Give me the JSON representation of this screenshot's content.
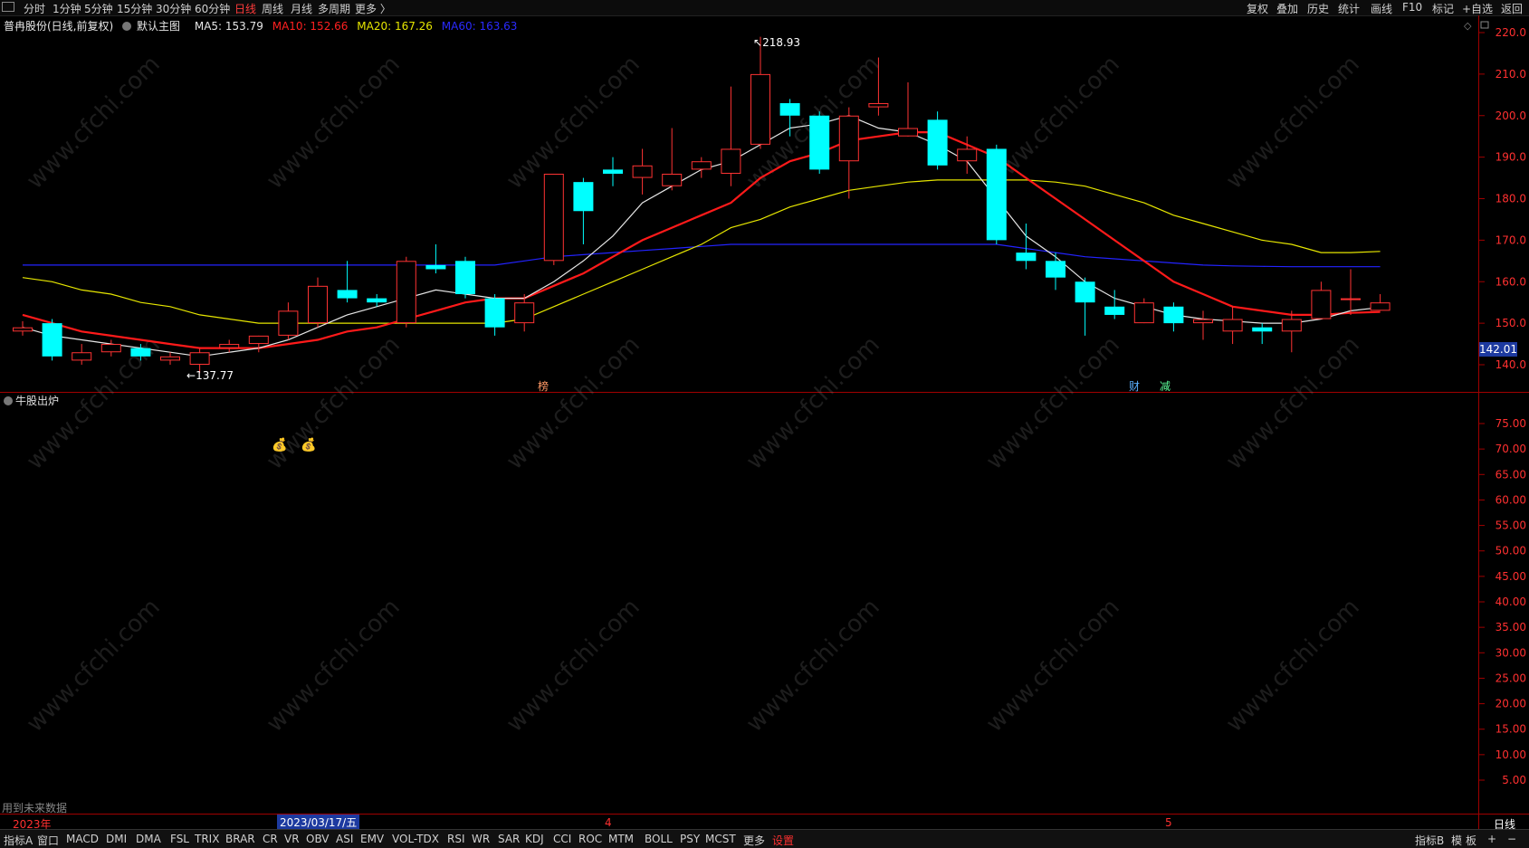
{
  "toolbar": {
    "periods": [
      "分时",
      "1分钟",
      "5分钟",
      "15分钟",
      "30分钟",
      "60分钟",
      "日线",
      "周线",
      "月线",
      "多周期",
      "更多 〉"
    ],
    "active_period": "日线",
    "right_items": [
      "复权",
      "叠加",
      "历史",
      "统计",
      "画线",
      "F10",
      "标记",
      "+自选",
      "返回"
    ]
  },
  "legend": {
    "stock_title": "普冉股份(日线,前复权)",
    "main_chart": "默认主图",
    "ma5": "MA5: 153.79",
    "ma10": "MA10: 152.66",
    "ma20": "MA20: 167.26",
    "ma60": "MA60: 163.63"
  },
  "colors": {
    "up": "#ff3333",
    "down": "#00ffff",
    "ma5": "#e6e6e6",
    "ma10": "#ff1a1a",
    "ma20": "#e6e600",
    "ma60": "#2323ff",
    "axis": "#c00000"
  },
  "price_axis": {
    "ticks": [
      "220.0",
      "210.0",
      "200.0",
      "190.0",
      "180.0",
      "170.0",
      "160.0",
      "150.0",
      "140.0"
    ],
    "current_price_tag": "142.01"
  },
  "annotations": {
    "high": "218.93",
    "low": "137.77",
    "event_markers": [
      "榜",
      "财",
      "减"
    ]
  },
  "indicator_pane": {
    "title": "牛股出炉",
    "ticks": [
      "75.00",
      "70.00",
      "65.00",
      "60.00",
      "55.00",
      "50.00",
      "45.00",
      "40.00",
      "35.00",
      "30.00",
      "25.00",
      "20.00",
      "15.00",
      "10.00",
      "5.00"
    ],
    "future_data_note": "用到未来数据"
  },
  "time_axis": {
    "year_label": "2023年",
    "month_labels": [
      "4",
      "5"
    ],
    "cursor_date": "2023/03/17/五",
    "period": "日线"
  },
  "bottombar": {
    "items": [
      "指标A",
      "窗口",
      "MACD",
      "DMI",
      "DMA",
      "FSL",
      "TRIX",
      "BRAR",
      "CR",
      "VR",
      "OBV",
      "ASI",
      "EMV",
      "VOL-TDX",
      "RSI",
      "WR",
      "SAR",
      "KDJ",
      "CCI",
      "ROC",
      "MTM",
      "BOLL",
      "PSY",
      "MCST",
      "更多",
      "设置"
    ],
    "right_items": [
      "指标B",
      "模",
      "板",
      "+",
      "−"
    ]
  },
  "watermark": "www.cfchi.com",
  "chart_data": {
    "type": "candlestick",
    "ylim": [
      135,
      222
    ],
    "candles": [
      {
        "o": 148,
        "c": 149,
        "h": 150.5,
        "l": 147
      },
      {
        "o": 150,
        "c": 142,
        "h": 151,
        "l": 141
      },
      {
        "o": 141,
        "c": 143,
        "h": 145,
        "l": 140
      },
      {
        "o": 143,
        "c": 145,
        "h": 146,
        "l": 142
      },
      {
        "o": 144,
        "c": 142,
        "h": 145,
        "l": 141
      },
      {
        "o": 141,
        "c": 142,
        "h": 143,
        "l": 140
      },
      {
        "o": 140,
        "c": 143,
        "h": 144,
        "l": 138
      },
      {
        "o": 144,
        "c": 145,
        "h": 146,
        "l": 143
      },
      {
        "o": 145,
        "c": 147,
        "h": 147,
        "l": 143
      },
      {
        "o": 147,
        "c": 153,
        "h": 155,
        "l": 146
      },
      {
        "o": 150,
        "c": 159,
        "h": 161,
        "l": 149
      },
      {
        "o": 158,
        "c": 156,
        "h": 165,
        "l": 155
      },
      {
        "o": 156,
        "c": 155,
        "h": 157,
        "l": 154
      },
      {
        "o": 150,
        "c": 165,
        "h": 166,
        "l": 149
      },
      {
        "o": 164,
        "c": 163,
        "h": 169,
        "l": 162
      },
      {
        "o": 165,
        "c": 157,
        "h": 166,
        "l": 156
      },
      {
        "o": 156,
        "c": 149,
        "h": 157,
        "l": 147
      },
      {
        "o": 150,
        "c": 155,
        "h": 157,
        "l": 148
      },
      {
        "o": 165,
        "c": 186,
        "h": 186,
        "l": 164
      },
      {
        "o": 184,
        "c": 177,
        "h": 185,
        "l": 169
      },
      {
        "o": 187,
        "c": 186,
        "h": 190,
        "l": 183
      },
      {
        "o": 185,
        "c": 188,
        "h": 192,
        "l": 181
      },
      {
        "o": 183,
        "c": 186,
        "h": 197,
        "l": 182
      },
      {
        "o": 187,
        "c": 189,
        "h": 190,
        "l": 185
      },
      {
        "o": 186,
        "c": 192,
        "h": 207,
        "l": 183
      },
      {
        "o": 193,
        "c": 210,
        "h": 219,
        "l": 192
      },
      {
        "o": 203,
        "c": 200,
        "h": 204,
        "l": 195
      },
      {
        "o": 200,
        "c": 187,
        "h": 201,
        "l": 186
      },
      {
        "o": 189,
        "c": 200,
        "h": 202,
        "l": 180
      },
      {
        "o": 202,
        "c": 203,
        "h": 214,
        "l": 200
      },
      {
        "o": 195,
        "c": 197,
        "h": 208,
        "l": 195
      },
      {
        "o": 199,
        "c": 188,
        "h": 201,
        "l": 187
      },
      {
        "o": 189,
        "c": 192,
        "h": 195,
        "l": 186
      },
      {
        "o": 192,
        "c": 170,
        "h": 193,
        "l": 169
      },
      {
        "o": 167,
        "c": 165,
        "h": 174,
        "l": 163
      },
      {
        "o": 165,
        "c": 161,
        "h": 167,
        "l": 158
      },
      {
        "o": 160,
        "c": 155,
        "h": 161,
        "l": 147
      },
      {
        "o": 154,
        "c": 152,
        "h": 158,
        "l": 151
      },
      {
        "o": 150,
        "c": 155,
        "h": 156,
        "l": 150
      },
      {
        "o": 154,
        "c": 150,
        "h": 155,
        "l": 148
      },
      {
        "o": 150,
        "c": 151,
        "h": 153,
        "l": 146
      },
      {
        "o": 148,
        "c": 151,
        "h": 154,
        "l": 145
      },
      {
        "o": 149,
        "c": 148,
        "h": 150,
        "l": 145
      },
      {
        "o": 148,
        "c": 151,
        "h": 153,
        "l": 143
      },
      {
        "o": 151,
        "c": 158,
        "h": 160,
        "l": 151
      },
      {
        "o": 156,
        "c": 156,
        "h": 163,
        "l": 152
      },
      {
        "o": 153,
        "c": 155,
        "h": 157,
        "l": 153
      }
    ],
    "ma5": [
      149,
      147,
      146,
      145,
      144,
      143,
      142,
      143,
      144,
      146,
      149,
      152,
      154,
      156,
      158,
      157,
      156,
      156,
      160,
      165,
      171,
      179,
      183,
      187,
      189,
      193,
      197,
      198,
      200,
      197,
      196,
      193,
      189,
      180,
      171,
      166,
      160,
      156,
      154,
      152,
      151,
      150.5,
      150,
      150,
      151,
      153,
      153.8
    ],
    "ma10": [
      152,
      150,
      148,
      147,
      146,
      145,
      144,
      144,
      144,
      145,
      146,
      148,
      149,
      151,
      153,
      155,
      156,
      156,
      159,
      162,
      166,
      170,
      173,
      176,
      179,
      185,
      189,
      191,
      194,
      195,
      196,
      196,
      193,
      190,
      185,
      180,
      175,
      170,
      165,
      160,
      157,
      154,
      153,
      152,
      152,
      152.5,
      152.7
    ],
    "ma20": [
      161,
      160,
      158,
      157,
      155,
      154,
      152,
      151,
      150,
      150,
      150,
      150,
      150,
      150,
      150,
      150,
      150,
      151,
      154,
      157,
      160,
      163,
      166,
      169,
      173,
      175,
      178,
      180,
      182,
      183,
      184,
      184.5,
      184.5,
      184.5,
      184.5,
      184,
      183,
      181,
      179,
      176,
      174,
      172,
      170,
      169,
      167,
      167,
      167.3
    ],
    "ma60": [
      164,
      164,
      164,
      164,
      164,
      164,
      164,
      164,
      164,
      164,
      164,
      164,
      164,
      164,
      164,
      164,
      164,
      165,
      166,
      166.5,
      167,
      167.5,
      168,
      168.5,
      169,
      169,
      169,
      169,
      169,
      169,
      169,
      169,
      169,
      169,
      168,
      167,
      166,
      165.5,
      165,
      164.5,
      164,
      163.8,
      163.7,
      163.6,
      163.6,
      163.6,
      163.6
    ]
  }
}
